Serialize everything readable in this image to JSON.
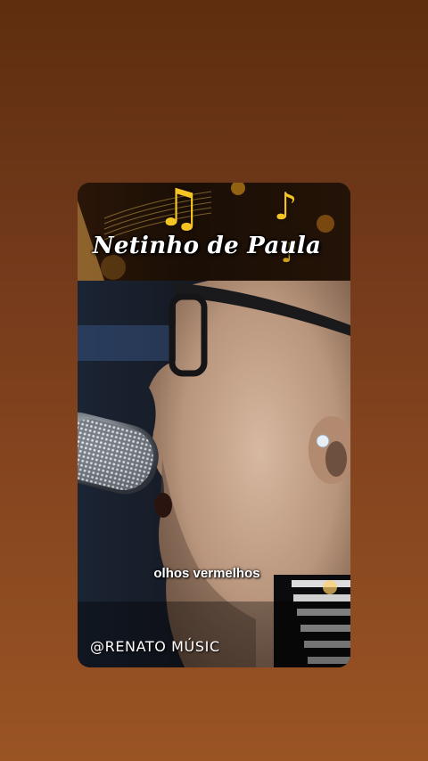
{
  "video": {
    "banner_title": "Netinho de Paula",
    "lyric_caption": "olhos  vermelhos",
    "watermark": "@RENATO MÚSIC"
  },
  "icons": {
    "banner_decoration": [
      "music-note-icon",
      "eighth-note-icon",
      "sixteenth-note-icon"
    ]
  },
  "colors": {
    "background_top": "#5e2e0f",
    "background_bottom": "#9a5424",
    "note_gold": "#f3c423",
    "caption_text": "#ffffff"
  }
}
